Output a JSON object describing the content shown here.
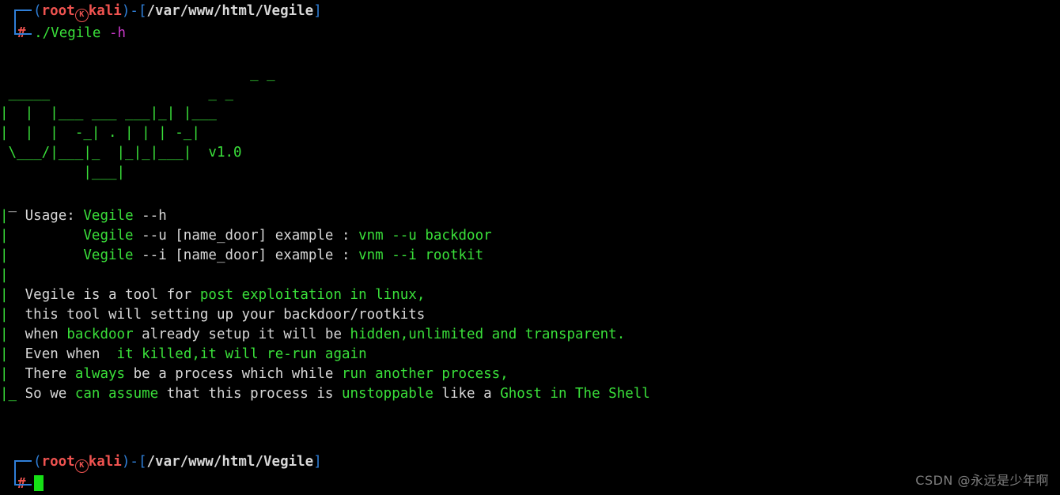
{
  "terminal": {
    "background_color": "#000000",
    "text_color": "#d8d8d8",
    "green_color": "#3ae03a",
    "red_color": "#ef5350",
    "blue_color": "#2f7fd8",
    "magenta_color": "#c838c8",
    "cursor_color": "#16e016"
  },
  "prompt_top": {
    "paren_open": "(",
    "user": "root",
    "at_symbol": "K",
    "host": "kali",
    "paren_close": ")",
    "dash": "-",
    "bracket_open": "[",
    "path": "/var/www/html/Vegile",
    "bracket_close": "]",
    "hash": "#",
    "command": "./Vegile",
    "flag": "-h"
  },
  "banner": {
    "lines": [
      "                              _ _",
      " _____                   ___|_| |___",
      "|  |  |___ ___ _|_| |___",
      "|  |  |  -_| . | | | -_|",
      " \\___/|___|_  |_|_|___|  v1.0",
      "          |___|"
    ],
    "art": [
      "                     _ _",
      " _____ ___ ___ _|_| |___",
      "|  |  |  -_| . | | | -_|",
      " \\___/|___|_  |_|_|___|",
      "          |___|"
    ],
    "version": "v1.0",
    "color": "#3ae03a"
  },
  "usage": {
    "label": "Usage:",
    "lines": [
      {
        "cmd": "Vegile",
        "args": " --h",
        "example_label": "",
        "example": ""
      },
      {
        "cmd": "Vegile",
        "args": " --u [name_door] example : ",
        "example": "vnm --u backdoor"
      },
      {
        "cmd": "Vegile",
        "args": " --i [name_door] example : ",
        "example": "vnm --i rootkit"
      }
    ]
  },
  "description": {
    "line1": {
      "plain1": "Vegile is a tool for ",
      "hl1": "post exploitation in linux,"
    },
    "line2": {
      "plain1": "this tool will setting up your backdoor/rootkits"
    },
    "line3": {
      "plain1": "when ",
      "hl1": "backdoor",
      "plain2": " already setup it will be ",
      "hl2": "hidden,unlimited and transparent."
    },
    "line4": {
      "plain1": "Even when  ",
      "hl1": "it killed,it will re-run again"
    },
    "line5": {
      "plain1": "There ",
      "hl1": "always",
      "plain2": " be a process which while ",
      "hl2": "run another process,"
    },
    "line6": {
      "gutter": "|_ ",
      "plain1": "So we ",
      "hl1": "can assume",
      "plain2": " that this process is ",
      "hl2": "unstoppable",
      "plain3": " like a ",
      "hl3": "Ghost in The Shell"
    }
  },
  "gutter": {
    "top_tick": "_",
    "pipe": "|",
    "bottom": "|_"
  },
  "prompt_bottom": {
    "paren_open": "(",
    "user": "root",
    "at_symbol": "K",
    "host": "kali",
    "paren_close": ")",
    "dash": "-",
    "bracket_open": "[",
    "path": "/var/www/html/Vegile",
    "bracket_close": "]",
    "hash": "#",
    "command": ""
  },
  "watermark": {
    "text": "CSDN @永远是少年啊"
  }
}
